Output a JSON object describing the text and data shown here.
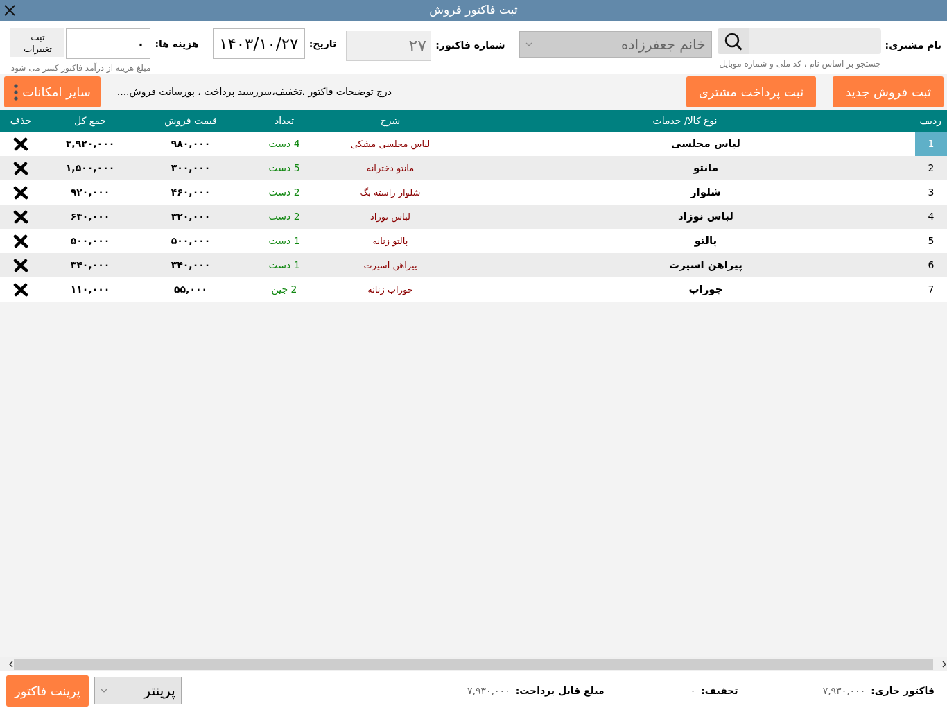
{
  "window": {
    "title": "ثبت فاکتور فروش"
  },
  "form": {
    "customer_label": "نام مشتری:",
    "customer_hint": "جستجو بر اساس نام ، کد ملی و شماره موبایل",
    "customer_select": {
      "value": "خانم جعفرزاده",
      "disabled": true
    },
    "invoice_number_label": "شماره فاکتور:",
    "invoice_number": "۲۷",
    "date_label": "تاریخ:",
    "date": "۱۴۰۳/۱۰/۲۷",
    "expenses_label": "هزینه ها:",
    "expenses": "۰",
    "expenses_hint": "مبلغ هزینه از درآمد فاکتور کسر می شود",
    "save_changes": "ثبت تغییرات"
  },
  "toolbar": {
    "buttons": [
      "ثبت فروش جدید",
      "ثبت پرداخت مشتری"
    ],
    "notes_link": "درج توضیحات فاکتور ،تخفیف،سررسید پرداخت ، پورسانت فروش....",
    "more_button": "سایر امکانات"
  },
  "table": {
    "columns": [
      "ردیف",
      "نوع کالا/ خدمات",
      "شرح",
      "تعداد",
      "قیمت فروش",
      "جمع کل",
      "حذف"
    ],
    "rows": [
      {
        "index": "1",
        "item": "لباس مجلسی",
        "description": "لباس مجلسی مشکی",
        "quantity": "4 دست",
        "price": "۹۸۰,۰۰۰",
        "total": "۳,۹۲۰,۰۰۰",
        "selected": true
      },
      {
        "index": "2",
        "item": "مانتو",
        "description": "مانتو دخترانه",
        "quantity": "5 دست",
        "price": "۳۰۰,۰۰۰",
        "total": "۱,۵۰۰,۰۰۰",
        "selected": false
      },
      {
        "index": "3",
        "item": "شلوار",
        "description": "شلوار راسته بگ",
        "quantity": "2 دست",
        "price": "۴۶۰,۰۰۰",
        "total": "۹۲۰,۰۰۰",
        "selected": false
      },
      {
        "index": "4",
        "item": "لباس نوزاد",
        "description": "لباس نوزاد",
        "quantity": "2 دست",
        "price": "۳۲۰,۰۰۰",
        "total": "۶۴۰,۰۰۰",
        "selected": false
      },
      {
        "index": "5",
        "item": "پالتو",
        "description": "پالتو زنانه",
        "quantity": "1 دست",
        "price": "۵۰۰,۰۰۰",
        "total": "۵۰۰,۰۰۰",
        "selected": false
      },
      {
        "index": "6",
        "item": "پیراهن اسپرت",
        "description": "پیراهن اسپرت",
        "quantity": "1 دست",
        "price": "۳۴۰,۰۰۰",
        "total": "۳۴۰,۰۰۰",
        "selected": false
      },
      {
        "index": "7",
        "item": "جوراب",
        "description": "جوراب زنانه",
        "quantity": "2 جین",
        "price": "۵۵,۰۰۰",
        "total": "۱۱۰,۰۰۰",
        "selected": false
      }
    ]
  },
  "footer": {
    "current_label": "فاکتور جاری:",
    "current_value": "۷,۹۳۰,۰۰۰",
    "discount_label": "تخفیف:",
    "discount_value": "۰",
    "payable_label": "مبلغ قابل پرداخت:",
    "payable_value": "۷,۹۳۰,۰۰۰",
    "printer_select": "پرینتر",
    "print_button": "پرینت فاکتور"
  }
}
